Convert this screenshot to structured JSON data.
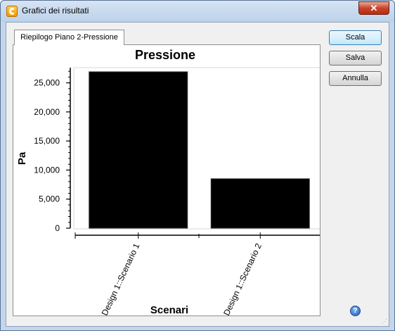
{
  "window": {
    "title": "Grafici dei risultati",
    "close_glyph": "✕"
  },
  "tabs": [
    {
      "label": "Riepilogo Piano 2-Pressione",
      "selected": true
    }
  ],
  "buttons": {
    "scala": "Scala",
    "salva": "Salva",
    "annulla": "Annulla"
  },
  "icons": {
    "app": "app-logo-icon",
    "help": "help-icon",
    "help_glyph": "?"
  },
  "chart_data": {
    "type": "bar",
    "title": "Pressione",
    "xlabel": "Scenari",
    "ylabel": "Pa",
    "categories": [
      "Design 1::Scenario 1",
      "Design 1::Scenario 2"
    ],
    "values": [
      26900,
      8500
    ],
    "ylim": [
      0,
      27500
    ],
    "yticks": [
      0,
      5000,
      10000,
      15000,
      20000,
      25000
    ],
    "ytick_labels": [
      "0",
      "5,000",
      "10,000",
      "15,000",
      "20,000",
      "25,000"
    ],
    "bar_color": "#000000",
    "grid": false,
    "legend": "none"
  }
}
